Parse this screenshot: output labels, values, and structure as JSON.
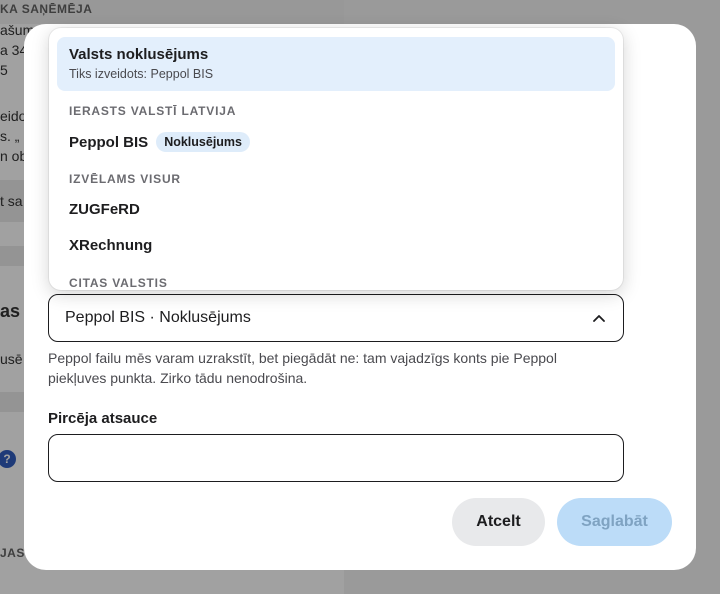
{
  "background": {
    "line1": "KA SAŅĒMĒJA",
    "line2": "ašums...",
    "line3": "a 34",
    "line4": "5",
    "line5": "eidot",
    "line6": "s. „",
    "line7": "n ob",
    "line8": "t sa",
    "line9": "as t",
    "line10": "usē",
    "help": "?",
    "line11": "JAS"
  },
  "dropdown": {
    "selected_option": {
      "title": "Valsts noklusējums",
      "subtitle": "Tiks izveidots: Peppol BIS"
    },
    "groups": [
      {
        "heading": "IERASTS VALSTĪ LATVIJA",
        "options": [
          {
            "label": "Peppol BIS",
            "badge": "Noklusējums"
          }
        ]
      },
      {
        "heading": "IZVĒLAMS VISUR",
        "options": [
          {
            "label": "ZUGFeRD"
          },
          {
            "label": "XRechnung"
          }
        ]
      },
      {
        "heading": "CITAS VALSTIS",
        "options": []
      }
    ]
  },
  "format_select": {
    "value": "Peppol BIS · Noklusējums",
    "hint": "Peppol failu mēs varam uzrakstīt, bet piegādāt ne: tam vajadzīgs konts pie Peppol piekļuves punkta. Zirko tādu nenodrošina."
  },
  "buyer_reference": {
    "label": "Pircēja atsauce",
    "value": ""
  },
  "actions": {
    "cancel_label": "Atcelt",
    "save_label": "Saglabāt"
  },
  "colors": {
    "accent_light": "#e3effc",
    "save_disabled": "#bcdcf8",
    "help_badge": "#1e4fb8"
  }
}
